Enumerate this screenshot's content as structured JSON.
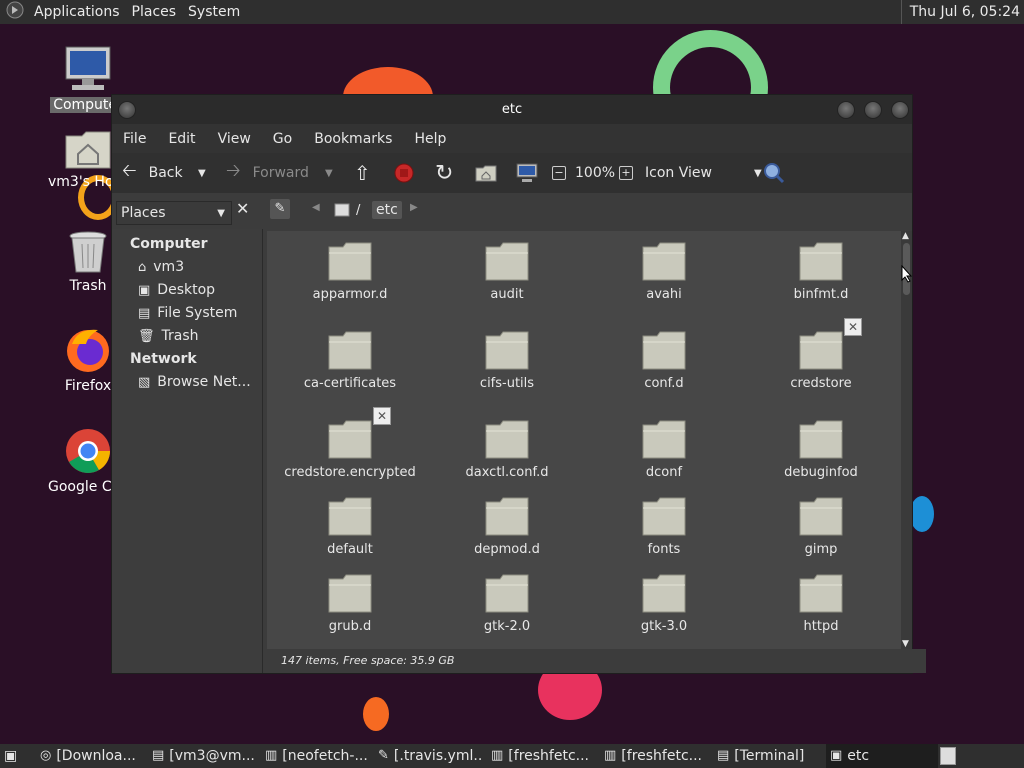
{
  "top_panel": {
    "menus": [
      "Applications",
      "Places",
      "System"
    ],
    "clock": "Thu Jul 6, 05:24"
  },
  "desktop": {
    "icons": [
      {
        "label": "Computer",
        "icon": "computer-icon"
      },
      {
        "label": "vm3's Home",
        "icon": "home-folder-icon"
      },
      {
        "label": "Trash",
        "icon": "trash-icon"
      },
      {
        "label": "Firefox",
        "icon": "firefox-icon"
      },
      {
        "label": "Google Chrome",
        "icon": "chrome-icon"
      }
    ]
  },
  "window": {
    "title": "etc",
    "menu": [
      "File",
      "Edit",
      "View",
      "Go",
      "Bookmarks",
      "Help"
    ],
    "toolbar": {
      "back": "Back",
      "forward": "Forward",
      "zoom": "100%",
      "view_mode": "Icon View"
    },
    "sidebar_selector": "Places",
    "path": {
      "root": "/",
      "current": "etc"
    },
    "sidebar": {
      "computer_heading": "Computer",
      "computer_items": [
        "vm3",
        "Desktop",
        "File System",
        "Trash"
      ],
      "network_heading": "Network",
      "network_items": [
        "Browse Net..."
      ]
    },
    "files": [
      {
        "name": "apparmor.d"
      },
      {
        "name": "audit"
      },
      {
        "name": "avahi"
      },
      {
        "name": "binfmt.d"
      },
      {
        "name": "ca-certificates"
      },
      {
        "name": "cifs-utils"
      },
      {
        "name": "conf.d"
      },
      {
        "name": "credstore",
        "locked": true
      },
      {
        "name": "credstore.encrypted",
        "locked": true
      },
      {
        "name": "daxctl.conf.d"
      },
      {
        "name": "dconf"
      },
      {
        "name": "debuginfod"
      },
      {
        "name": "default"
      },
      {
        "name": "depmod.d"
      },
      {
        "name": "fonts"
      },
      {
        "name": "gimp"
      },
      {
        "name": "grub.d"
      },
      {
        "name": "gtk-2.0"
      },
      {
        "name": "gtk-3.0"
      },
      {
        "name": "httpd"
      }
    ],
    "status": "147 items, Free space: 35.9 GB"
  },
  "taskbar": {
    "tasks": [
      "[Downloa...",
      "[vm3@vm...",
      "[neofetch-...",
      "[.travis.yml...",
      "[freshfetc...",
      "[freshfetc...",
      "[Terminal]",
      "etc"
    ]
  }
}
